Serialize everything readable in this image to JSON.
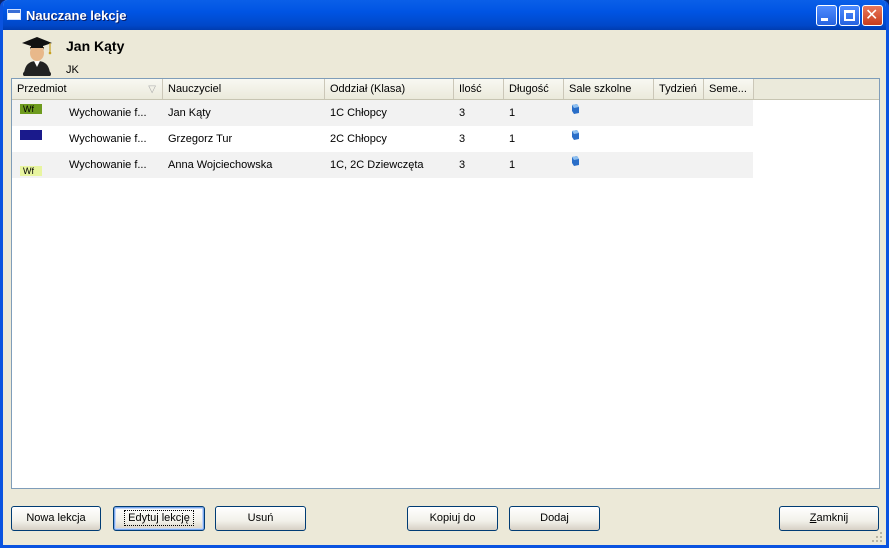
{
  "window": {
    "title": "Nauczane lekcje",
    "minimize_icon": "minimize-icon",
    "maximize_icon": "maximize-icon",
    "close_glyph": "✕"
  },
  "header": {
    "avatar_icon": "teacher-graduate-icon",
    "user_name": "Jan Kąty",
    "user_code": "JK"
  },
  "table": {
    "columns": [
      "Przedmiot",
      "Nauczyciel",
      "Oddział (Klasa)",
      "Ilość",
      "Długość",
      "Sale szkolne",
      "Tydzień",
      "Seme..."
    ],
    "sort_column": "Przedmiot",
    "rows": [
      {
        "swatch_label": "Wf",
        "swatch_color": "#6e9b1e",
        "subject": "Wychowanie f...",
        "teacher": "Jan Kąty",
        "class": "1C Chłopcy",
        "count": "3",
        "length": "1",
        "rooms_icon": "classroom-icon",
        "week": "",
        "semester": ""
      },
      {
        "swatch_label": "",
        "swatch_color": "#1a1a8c",
        "subject": "Wychowanie f...",
        "teacher": "Grzegorz Tur",
        "class": "2C Chłopcy",
        "count": "3",
        "length": "1",
        "rooms_icon": "classroom-icon",
        "week": "",
        "semester": ""
      },
      {
        "swatch_label": "Wf",
        "swatch_color": "#e8f5a0",
        "subject": "Wychowanie f...",
        "teacher": "Anna Wojciechowska",
        "class": "1C, 2C Dziewczęta",
        "count": "3",
        "length": "1",
        "rooms_icon": "classroom-icon",
        "week": "",
        "semester": ""
      }
    ]
  },
  "buttons": {
    "new_lesson": "Nowa lekcja",
    "edit_lesson": "Edytuj lekcję",
    "delete": "Usuń",
    "copy_to": "Kopiuj do",
    "add": "Dodaj",
    "close_pre": "Z",
    "close_rest": "amknij"
  },
  "colors": {
    "title_bar": "#0054e3",
    "selection_row": "#f2f2f2"
  }
}
